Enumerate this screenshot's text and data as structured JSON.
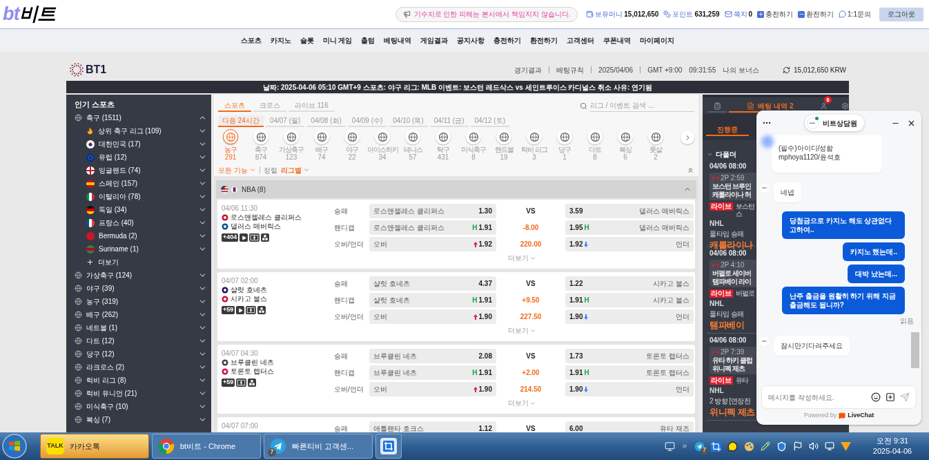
{
  "header": {
    "logo": {
      "latin": "bt",
      "hangul": "비트"
    },
    "notice": "기수치로 인한 피해는 본사에서 책임지지 않습니다.",
    "account": [
      {
        "kind": "money",
        "label": "보유머니",
        "value": "15,012,650"
      },
      {
        "kind": "point",
        "label": "포인트",
        "value": "631,259"
      },
      {
        "kind": "mail",
        "label": "쪽지",
        "value": "0"
      },
      {
        "kind": "plus",
        "label": "충전하기"
      },
      {
        "kind": "minus",
        "label": "환전하기"
      },
      {
        "kind": "chat",
        "label": "1:1문의"
      }
    ],
    "logout": "로그아웃"
  },
  "nav": [
    "스포츠",
    "카지노",
    "슬롯",
    "미니 게임",
    "출텀",
    "베팅내역",
    "게임결과",
    "공지사항",
    "충전하기",
    "환전하기",
    "고객센터",
    "쿠폰내역",
    "마이페이지"
  ],
  "site": {
    "logo": "BT1",
    "links": [
      "경기결과",
      "배팅규칙",
      "2025/04/06",
      "GMT +9:00",
      "09:31:55"
    ],
    "bonus": "나의 보너스",
    "balance": "15,012,650 KRW",
    "ticker": "날짜: 2025-04-06 05:10 GMT+9 스포츠: 야구 리그: MLB 이벤트: 보스턴 레드삭스 vs 세인트루이스 카디널스 취소 사유: 연기됨"
  },
  "sidebar": {
    "title": "인기 스포츠",
    "items": [
      {
        "label": "축구 (1511)",
        "expanded": true,
        "more": "더보기",
        "children": [
          {
            "kind": "hot",
            "label": "상위 축구 리그 (109)",
            "expanded": false
          },
          {
            "kind": "flag",
            "label": "대한민국 (17)",
            "expanded": false
          },
          {
            "kind": "flag",
            "label": "유럽 (12)",
            "expanded": false
          },
          {
            "kind": "flag",
            "label": "잉글랜드 (74)",
            "expanded": false
          },
          {
            "kind": "flag",
            "label": "스페인 (157)",
            "expanded": false
          },
          {
            "kind": "flag",
            "label": "이탈리아 (78)",
            "expanded": false
          },
          {
            "kind": "flag",
            "label": "독일 (34)",
            "expanded": false
          },
          {
            "kind": "flag",
            "label": "프랑스 (40)",
            "expanded": false
          },
          {
            "kind": "flag",
            "label": "Bermuda (2)",
            "expanded": false
          },
          {
            "kind": "flag",
            "label": "Suriname (1)",
            "expanded": false
          }
        ]
      },
      {
        "label": "가상축구 (124)",
        "expanded": false
      },
      {
        "label": "야구 (39)",
        "expanded": false
      },
      {
        "label": "농구 (319)",
        "expanded": false
      },
      {
        "label": "배구 (262)",
        "expanded": false
      },
      {
        "label": "네트볼 (1)",
        "expanded": false
      },
      {
        "label": "다트 (12)",
        "expanded": false
      },
      {
        "label": "당구 (12)",
        "expanded": false
      },
      {
        "label": "라크로스 (2)",
        "expanded": false
      },
      {
        "label": "럭비 리그 (8)",
        "expanded": false
      },
      {
        "label": "럭비 유니언 (21)",
        "expanded": false
      },
      {
        "label": "미식축구 (10)",
        "expanded": false
      },
      {
        "label": "복싱 (7)",
        "expanded": false
      }
    ]
  },
  "sports_tabs": [
    {
      "label": "스포츠",
      "selected": true
    },
    {
      "label": "크로스",
      "selected": false
    },
    {
      "label": "라이브 116",
      "selected": false
    }
  ],
  "search": {
    "placeholder": "리그 / 이벤트 검색 ..."
  },
  "date_tabs": [
    {
      "label": "다음 24시간",
      "selected": true
    },
    {
      "label": "04/07 (월)",
      "selected": false
    },
    {
      "label": "04/08 (화)",
      "selected": false
    },
    {
      "label": "04/09 (수)",
      "selected": false
    },
    {
      "label": "04/10 (목)",
      "selected": false
    },
    {
      "label": "04/11 (금)",
      "selected": false
    },
    {
      "label": "04/12 (토)",
      "selected": false
    }
  ],
  "sports": [
    {
      "name": "농구",
      "count": "291",
      "selected": true
    },
    {
      "name": "축구",
      "count": "874",
      "selected": false
    },
    {
      "name": "가상축구",
      "count": "123",
      "selected": false
    },
    {
      "name": "배구",
      "count": "74",
      "selected": false
    },
    {
      "name": "야구",
      "count": "22",
      "selected": false
    },
    {
      "name": "아이스하키",
      "count": "34",
      "selected": false
    },
    {
      "name": "테니스",
      "count": "57",
      "selected": false
    },
    {
      "name": "탁구",
      "count": "431",
      "selected": false
    },
    {
      "name": "미식축구",
      "count": "8",
      "selected": false
    },
    {
      "name": "핸드볼",
      "count": "19",
      "selected": false
    },
    {
      "name": "럭비 리그",
      "count": "3",
      "selected": false
    },
    {
      "name": "당구",
      "count": "1",
      "selected": false
    },
    {
      "name": "다트",
      "count": "8",
      "selected": false
    },
    {
      "name": "복싱",
      "count": "6",
      "selected": false
    },
    {
      "name": "풋살",
      "count": "2",
      "selected": false
    }
  ],
  "filters": {
    "features": "모든 기능",
    "sort_label": "정렬",
    "sort_value": "리그별"
  },
  "league": {
    "name": "NBA (8)",
    "expanded": true
  },
  "matches": [
    {
      "time": "04/06 11:30",
      "teams": [
        "로스앤젤레스 클리퍼스",
        "댈러스 매버릭스"
      ],
      "badges": [
        {
          "kind": "count",
          "text": "+404"
        },
        {
          "kind": "video"
        },
        {
          "kind": "field"
        },
        {
          "kind": "stats"
        }
      ],
      "more": "더보기",
      "markets": [
        {
          "label": "승패",
          "left": {
            "name": "로스앤젤레스 클리퍼스",
            "odds": "1.30"
          },
          "center": {
            "text": "VS",
            "highlight": false
          },
          "right": {
            "odds": "3.59",
            "name": "댈러스 매버릭스"
          }
        },
        {
          "label": "핸디캡",
          "left": {
            "name": "로스앤젤레스 클리퍼스",
            "odds": "1.91",
            "tag": "H"
          },
          "center": {
            "text": "-8.00",
            "highlight": true
          },
          "right": {
            "odds": "1.95",
            "tag": "H",
            "name": "댈러스 매버릭스"
          }
        },
        {
          "label": "오버/언더",
          "left": {
            "name": "오버",
            "odds": "1.92",
            "rising": true
          },
          "center": {
            "text": "220.00",
            "highlight": true
          },
          "right": {
            "odds": "1.92",
            "rising": false,
            "name": "언더"
          }
        }
      ]
    },
    {
      "time": "04/07 02:00",
      "teams": [
        "샬럿 호네츠",
        "시카고 불스"
      ],
      "badges": [
        {
          "kind": "count",
          "text": "+59"
        },
        {
          "kind": "video"
        },
        {
          "kind": "field"
        },
        {
          "kind": "stats"
        }
      ],
      "more": "더보기",
      "markets": [
        {
          "label": "승패",
          "left": {
            "name": "샬럿 호네츠",
            "odds": "4.37"
          },
          "center": {
            "text": "VS",
            "highlight": false
          },
          "right": {
            "odds": "1.22",
            "name": "시카고 불스"
          }
        },
        {
          "label": "핸디캡",
          "left": {
            "name": "샬럿 호네츠",
            "odds": "1.91",
            "tag": "H"
          },
          "center": {
            "text": "+9.50",
            "highlight": true
          },
          "right": {
            "odds": "1.91",
            "tag": "H",
            "name": "시카고 불스"
          }
        },
        {
          "label": "오버/언더",
          "left": {
            "name": "오버",
            "odds": "1.90",
            "rising": true
          },
          "center": {
            "text": "227.50",
            "highlight": true
          },
          "right": {
            "odds": "1.90",
            "rising": false,
            "name": "언더"
          }
        }
      ]
    },
    {
      "time": "04/07 04:30",
      "teams": [
        "브루클린 네츠",
        "토론토 랩터스"
      ],
      "badges": [
        {
          "kind": "count",
          "text": "+59"
        },
        {
          "kind": "field"
        },
        {
          "kind": "stats"
        }
      ],
      "more": "더보기",
      "markets": [
        {
          "label": "승패",
          "left": {
            "name": "브루클린 네츠",
            "odds": "2.08"
          },
          "center": {
            "text": "VS",
            "highlight": false
          },
          "right": {
            "odds": "1.73",
            "name": "토론토 랩터스"
          }
        },
        {
          "label": "핸디캡",
          "left": {
            "name": "브루클린 네츠",
            "odds": "1.91",
            "tag": "H"
          },
          "center": {
            "text": "+2.00",
            "highlight": true
          },
          "right": {
            "odds": "1.91",
            "tag": "H",
            "name": "토론토 랩터스"
          }
        },
        {
          "label": "오버/언더",
          "left": {
            "name": "오버",
            "odds": "1.90",
            "rising": true
          },
          "center": {
            "text": "214.50",
            "highlight": true
          },
          "right": {
            "odds": "1.90",
            "rising": false,
            "name": "언더"
          }
        }
      ]
    },
    {
      "time": "04/07 07:00",
      "markets": [
        {
          "label": "승패",
          "left": {
            "name": "애틀랜타 호크스",
            "odds": "1.12"
          },
          "center": {
            "text": "VS",
            "highlight": false
          },
          "right": {
            "odds": "6.00",
            "name": "유타 재즈"
          }
        }
      ]
    }
  ],
  "bet_panel": {
    "tabs": [
      {
        "kind": "list",
        "selected": false
      },
      {
        "kind": "slip",
        "label": "베팅 내역 2",
        "selected": true
      },
      {
        "kind": "user",
        "badge": "$",
        "selected": false
      },
      {
        "kind": "gear",
        "selected": false
      }
    ],
    "status_tabs": [
      {
        "label": "진행중",
        "selected": true
      }
    ],
    "section": {
      "label": "다폴더",
      "expanded": true
    },
    "bets": [
      {
        "date": "04/06 08:00",
        "clock": "2P 2:59",
        "teams": [
          "보스턴 브루인",
          "캐롤라이나 허"
        ],
        "badge": "라이브",
        "pick": [
          "보스턴",
          "스"
        ],
        "league": "NHL",
        "market": "풀타임 승패",
        "selection": "캐롤라이나"
      },
      {
        "date": "04/06 08:00",
        "clock": "2P 4:10",
        "teams": [
          "버펄로 세이버",
          "탬파베이 라이"
        ],
        "badge": "라이브",
        "pick": [
          "버펄로"
        ],
        "league": "NHL",
        "market": "풀타임 승패",
        "selection": "탬파베이"
      },
      {
        "date": "04/06 08:00",
        "clock": "2P 7:39",
        "teams": [
          "유타 하키 클럽",
          "위니펙 제츠"
        ],
        "badge": "라이브",
        "pick": [
          "유타"
        ],
        "league": "NHL",
        "market": "2 방향 [연장전",
        "selection": "위니펙 제츠"
      }
    ]
  },
  "chat": {
    "agent": "비트상담원",
    "online": true,
    "messages": [
      {
        "mine": false,
        "text": "(필수)아이디/성함\nmphoya1120/윤석호"
      },
      {
        "mine": false,
        "text": "네넵"
      },
      {
        "mine": true,
        "text": "당첨금으로 카지노 해도 상관없다 고하여.."
      },
      {
        "mine": true,
        "text": "카지노 했는데.."
      },
      {
        "mine": true,
        "text": "대박 났는데..."
      },
      {
        "mine": true,
        "text": "난주 출금을 원활히 하기 위해 지금 출금해도 됩니까?",
        "receipt": "읽음"
      },
      {
        "mine": false,
        "text": "잠시만기다려주세요"
      }
    ],
    "input": {
      "placeholder": "메시지를 작성하세요."
    },
    "powered_by": "Powered by",
    "brand": "LiveChat"
  },
  "taskbar": {
    "apps": [
      {
        "kind": "kakao",
        "icon_text": "TALK",
        "label": "카카오톡",
        "selected": true
      },
      {
        "kind": "browser",
        "label": "bt비트 - Chrome",
        "selected": false
      },
      {
        "kind": "telegram",
        "label": "빠른티비 고객센...",
        "badge": "7",
        "selected": false
      },
      {
        "kind": "tool",
        "selected": false
      }
    ],
    "tray_badge": "7",
    "time": "오전 9:31",
    "date": "2025-04-06"
  }
}
